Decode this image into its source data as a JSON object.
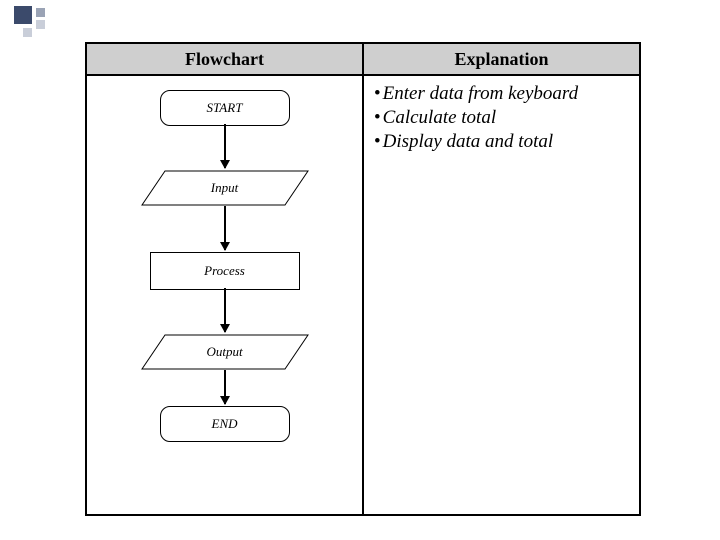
{
  "header": {
    "left": "Flowchart",
    "right": "Explanation"
  },
  "flowchart": {
    "start": "START",
    "input": "Input",
    "process": "Process",
    "output": "Output",
    "end": "END"
  },
  "explanation": {
    "b1": "Enter data from keyboard",
    "b2": "Calculate total",
    "b3": "Display data and total"
  }
}
